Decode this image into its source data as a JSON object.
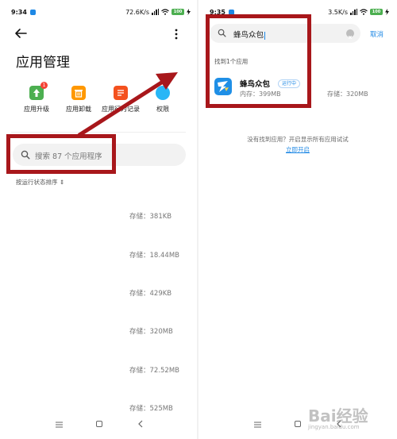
{
  "colors": {
    "accent": "#1e88e5",
    "annotation": "#a8171b",
    "upgrade_icon": "#4caf50",
    "uninstall_icon": "#ff9800",
    "record_icon": "#f4511e",
    "permission_icon": "#29b6f6",
    "battery": "#4caf50"
  },
  "left": {
    "status": {
      "time": "9:34",
      "speed": "72.6K/s",
      "battery": "100"
    },
    "title": "应用管理",
    "quick_actions": [
      {
        "label": "应用升级",
        "icon": "upgrade-icon",
        "badge": "1"
      },
      {
        "label": "应用卸载",
        "icon": "trash-icon"
      },
      {
        "label": "应用行为记录",
        "icon": "record-icon"
      },
      {
        "label": "权限",
        "icon": "permission-icon"
      }
    ],
    "search": {
      "placeholder": "搜索 87 个应用程序"
    },
    "sort_label": "按运行状态排序 ⇕",
    "storage_items": [
      "存储：381KB",
      "存储：18.44MB",
      "存储：429KB",
      "存储：320MB",
      "存储：72.52MB",
      "存储：525MB"
    ]
  },
  "right": {
    "status": {
      "time": "9:35",
      "speed": "3.5K/s",
      "battery": "100"
    },
    "search": {
      "value": "蜂鸟众包"
    },
    "cancel_label": "取消",
    "found_label": "找到1个应用",
    "result": {
      "name": "蜂鸟众包",
      "status_badge": "运行中",
      "memory": "内存：399MB",
      "storage": "存储：320MB"
    },
    "notfound_text": "没有找到应用？开启显示所有应用试试",
    "open_link": "立即开启"
  },
  "watermark": {
    "main": "Bai经验",
    "sub": "jingyan.baidu.com"
  }
}
